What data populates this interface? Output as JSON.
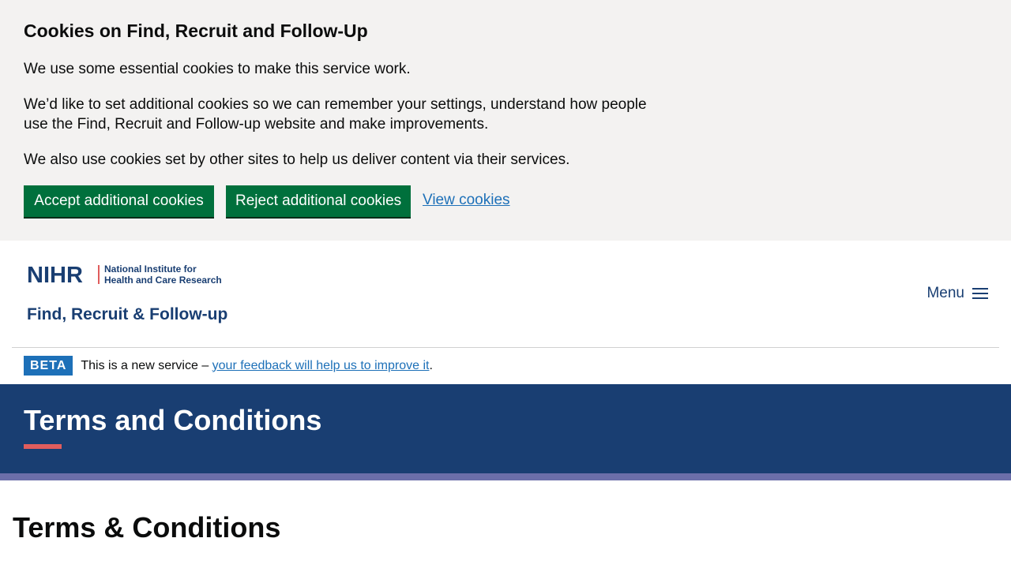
{
  "cookie_banner": {
    "title": "Cookies on Find, Recruit and Follow-Up",
    "para1": "We use some essential cookies to make this service work.",
    "para2": "We’d like to set additional cookies so we can remember your settings, understand how people use the Find, Recruit and Follow-up website and make improvements.",
    "para3": "We also use cookies set by other sites to help us deliver content via their services.",
    "accept_label": "Accept additional cookies",
    "reject_label": "Reject additional cookies",
    "view_label": "View cookies"
  },
  "header": {
    "logo_mark": "NIHR",
    "logo_sub1": "National Institute for",
    "logo_sub2": "Health and Care Research",
    "service_name": "Find, Recruit & Follow-up",
    "menu_label": "Menu"
  },
  "beta": {
    "tag": "BETA",
    "text": "This is a new service – ",
    "link": "your feedback will help us to improve it",
    "end": "."
  },
  "hero": {
    "title": "Terms and Conditions"
  },
  "main": {
    "heading": "Terms & Conditions"
  },
  "colors": {
    "primary_button": "#00703c",
    "link": "#1d70b8",
    "hero_background": "#193e72",
    "accent": "#e05d5d",
    "strip": "#6b6ea9"
  },
  "icons": {
    "menu": "hamburger-icon"
  }
}
